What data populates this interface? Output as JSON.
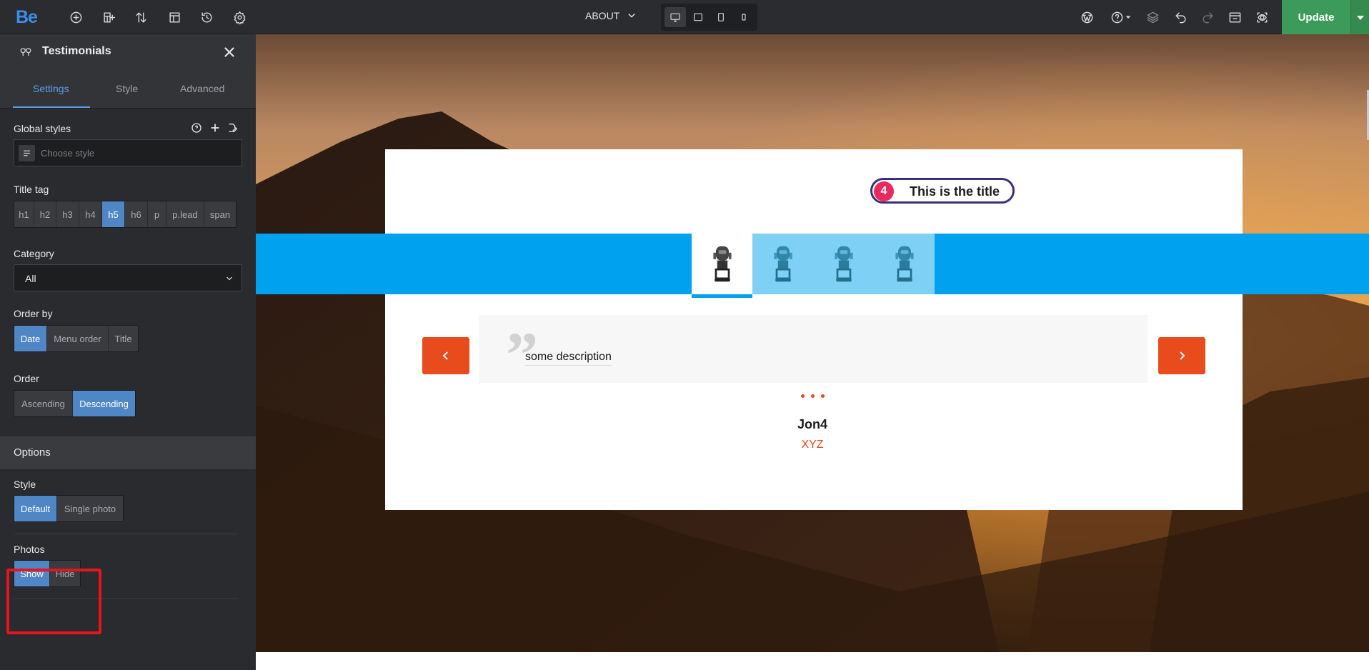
{
  "topbar": {
    "logo": "Be",
    "page_name": "ABOUT",
    "update_label": "Update",
    "left_icons": [
      "add-element-icon",
      "add-layout-icon",
      "sort-icon",
      "templates-icon",
      "history-icon",
      "settings-icon"
    ],
    "right_icons": [
      "wordpress-icon",
      "help-icon",
      "layers-icon",
      "undo-icon",
      "redo-icon",
      "export-icon",
      "preview-icon"
    ],
    "devices": [
      "desktop",
      "tablet-landscape",
      "tablet-portrait",
      "mobile"
    ],
    "active_device": "desktop"
  },
  "sidebar": {
    "title": "Testimonials",
    "tabs": [
      {
        "label": "Settings",
        "active": true
      },
      {
        "label": "Style",
        "active": false
      },
      {
        "label": "Advanced",
        "active": false
      }
    ],
    "global_styles": {
      "label": "Global styles",
      "placeholder": "Choose style"
    },
    "title_tag": {
      "label": "Title tag",
      "options": [
        "h1",
        "h2",
        "h3",
        "h4",
        "h5",
        "h6",
        "p",
        "p.lead",
        "span"
      ],
      "selected": "h5"
    },
    "category": {
      "label": "Category",
      "value": "All"
    },
    "order_by": {
      "label": "Order by",
      "options": [
        "Date",
        "Menu order",
        "Title"
      ],
      "selected": "Date"
    },
    "order": {
      "label": "Order",
      "options": [
        "Ascending",
        "Descending"
      ],
      "selected": "Descending"
    },
    "options_section": "Options",
    "style": {
      "label": "Style",
      "options": [
        "Default",
        "Single photo"
      ],
      "selected": "Default"
    },
    "photos": {
      "label": "Photos",
      "options": [
        "Show",
        "Hide"
      ],
      "selected": "Show"
    }
  },
  "canvas": {
    "title_number": "4",
    "title_text": "This is the title",
    "description": "some description",
    "author": "Jon4",
    "company": "XYZ",
    "colors": {
      "accent_orange": "#e84b1c",
      "band_blue": "#00a1ef",
      "thumb_blue": "#7fd0f5",
      "pill_border": "#3a2f7c",
      "pill_number": "#ea2a5f",
      "update_green": "#3c9b5a"
    },
    "thumbnails": 4,
    "active_thumbnail": 0
  }
}
